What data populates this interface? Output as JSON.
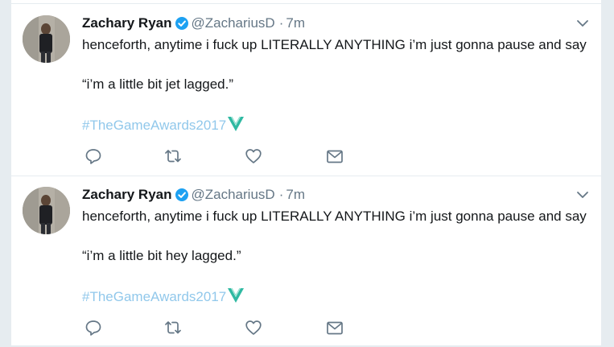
{
  "tweets": [
    {
      "author_name": "Zachary Ryan",
      "handle": "@ZachariusD",
      "separator": "·",
      "time": "7m",
      "text_line1": "henceforth, anytime i fuck up LITERALLY ANYTHING i’m just gonna pause and say",
      "text_line2": "“i’m a little bit jet lagged.”",
      "hashtag": "#TheGameAwards2017",
      "verified": true
    },
    {
      "author_name": "Zachary Ryan",
      "handle": "@ZachariusD",
      "separator": "·",
      "time": "7m",
      "text_line1": "henceforth, anytime i fuck up LITERALLY ANYTHING i’m just gonna pause and say",
      "text_line2": "“i’m a little bit hey lagged.”",
      "hashtag": "#TheGameAwards2017",
      "verified": true
    }
  ],
  "icons": {
    "caret": "chevron-down-icon",
    "verified": "verified-badge-icon",
    "hashflag": "game-awards-hashflag-icon",
    "reply": "reply-icon",
    "retweet": "retweet-icon",
    "like": "heart-icon",
    "dm": "envelope-icon"
  },
  "colors": {
    "text": "#14171a",
    "secondary": "#657786",
    "verified": "#1da1f2",
    "hashtag": "#91c8eb",
    "hashflag": "#2fb9a2",
    "action": "#657786",
    "page_background": "#e6ecf0"
  }
}
